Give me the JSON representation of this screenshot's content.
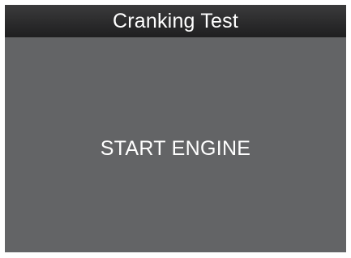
{
  "header": {
    "title": "Cranking Test"
  },
  "main": {
    "prompt": "START ENGINE"
  },
  "colors": {
    "screen_background": "#636466",
    "title_bar_background": "#2b2b2c",
    "text": "#ffffff"
  }
}
